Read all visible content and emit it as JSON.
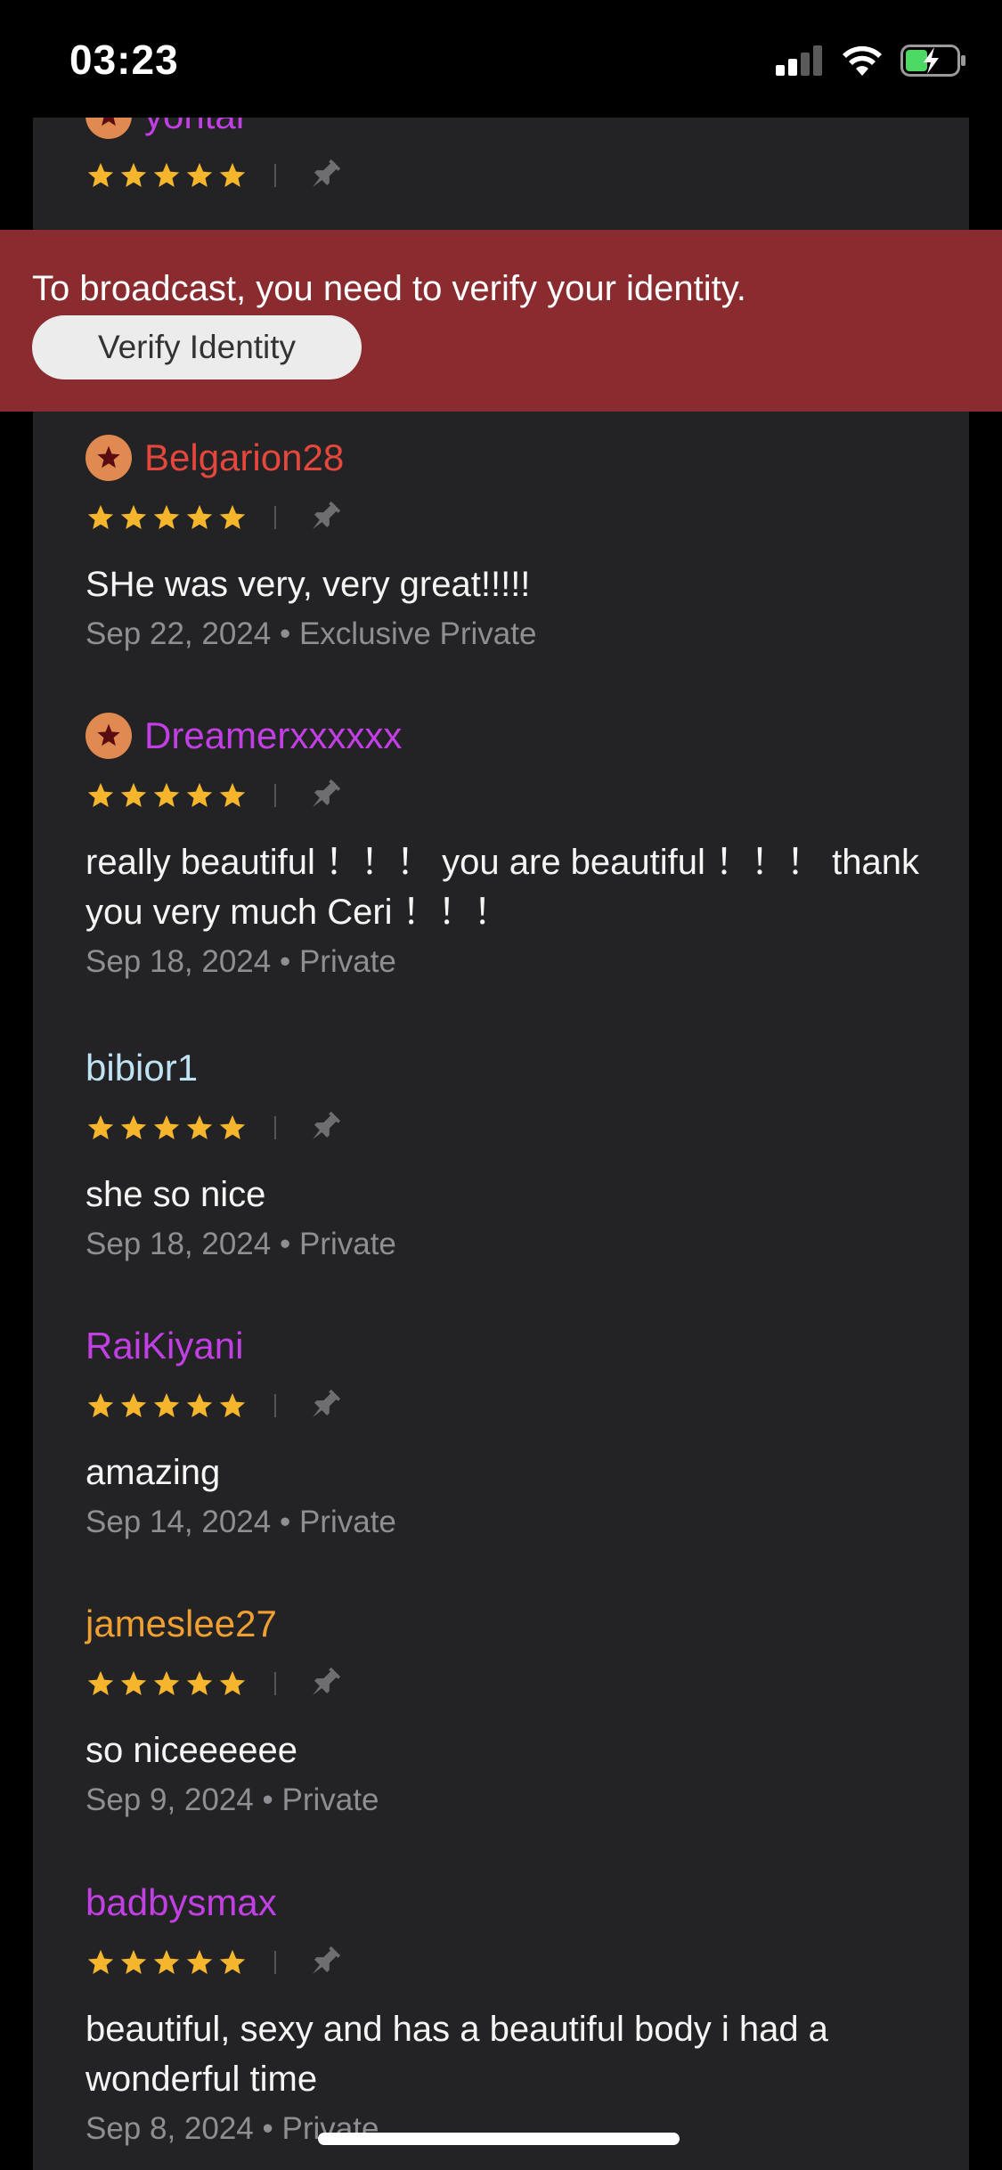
{
  "status_bar": {
    "time": "03:23"
  },
  "banner": {
    "message": "To broadcast, you need to verify your identity.",
    "button_label": "Verify Identity"
  },
  "reviews": [
    {
      "username": "yontar",
      "name_color": "#c23fe3",
      "badge": true,
      "stars": 5,
      "text": "",
      "date": "",
      "type": ""
    },
    {
      "username": "Belgarion28",
      "name_color": "#e5473c",
      "badge": true,
      "stars": 5,
      "text": "SHe was very, very great!!!!!",
      "date": "Sep 22, 2024",
      "type": "Exclusive Private"
    },
    {
      "username": "Dreamerxxxxxx",
      "name_color": "#c23fe3",
      "badge": true,
      "stars": 5,
      "text": "really beautiful ！！！ you are beautiful ！！！ thank you very much Ceri ！！！",
      "date": "Sep 18, 2024",
      "type": "Private"
    },
    {
      "username": "bibior1",
      "name_color": "#bfe3f2",
      "badge": false,
      "stars": 5,
      "text": "she so nice",
      "date": "Sep 18, 2024",
      "type": "Private"
    },
    {
      "username": "RaiKiyani",
      "name_color": "#c23fe3",
      "badge": false,
      "stars": 5,
      "text": "amazing",
      "date": "Sep 14, 2024",
      "type": "Private"
    },
    {
      "username": "jameslee27",
      "name_color": "#f0a030",
      "badge": false,
      "stars": 5,
      "text": "so niceeeeee",
      "date": "Sep 9, 2024",
      "type": "Private"
    },
    {
      "username": "badbysmax",
      "name_color": "#c23fe3",
      "badge": false,
      "stars": 5,
      "text": "beautiful, sexy and has a beautiful body i had a wonderful time",
      "date": "Sep 8, 2024",
      "type": "Private"
    }
  ],
  "icons": {
    "badge": "star-badge-icon",
    "star": "star-icon",
    "pin": "pin-icon",
    "signal": "cellular-signal-icon",
    "wifi": "wifi-icon",
    "battery": "battery-charging-icon"
  },
  "colors": {
    "star": "#f5b62e",
    "badge_bg": "#e08a52",
    "banner_bg": "#8a2b2f",
    "panel_bg": "#232325"
  }
}
